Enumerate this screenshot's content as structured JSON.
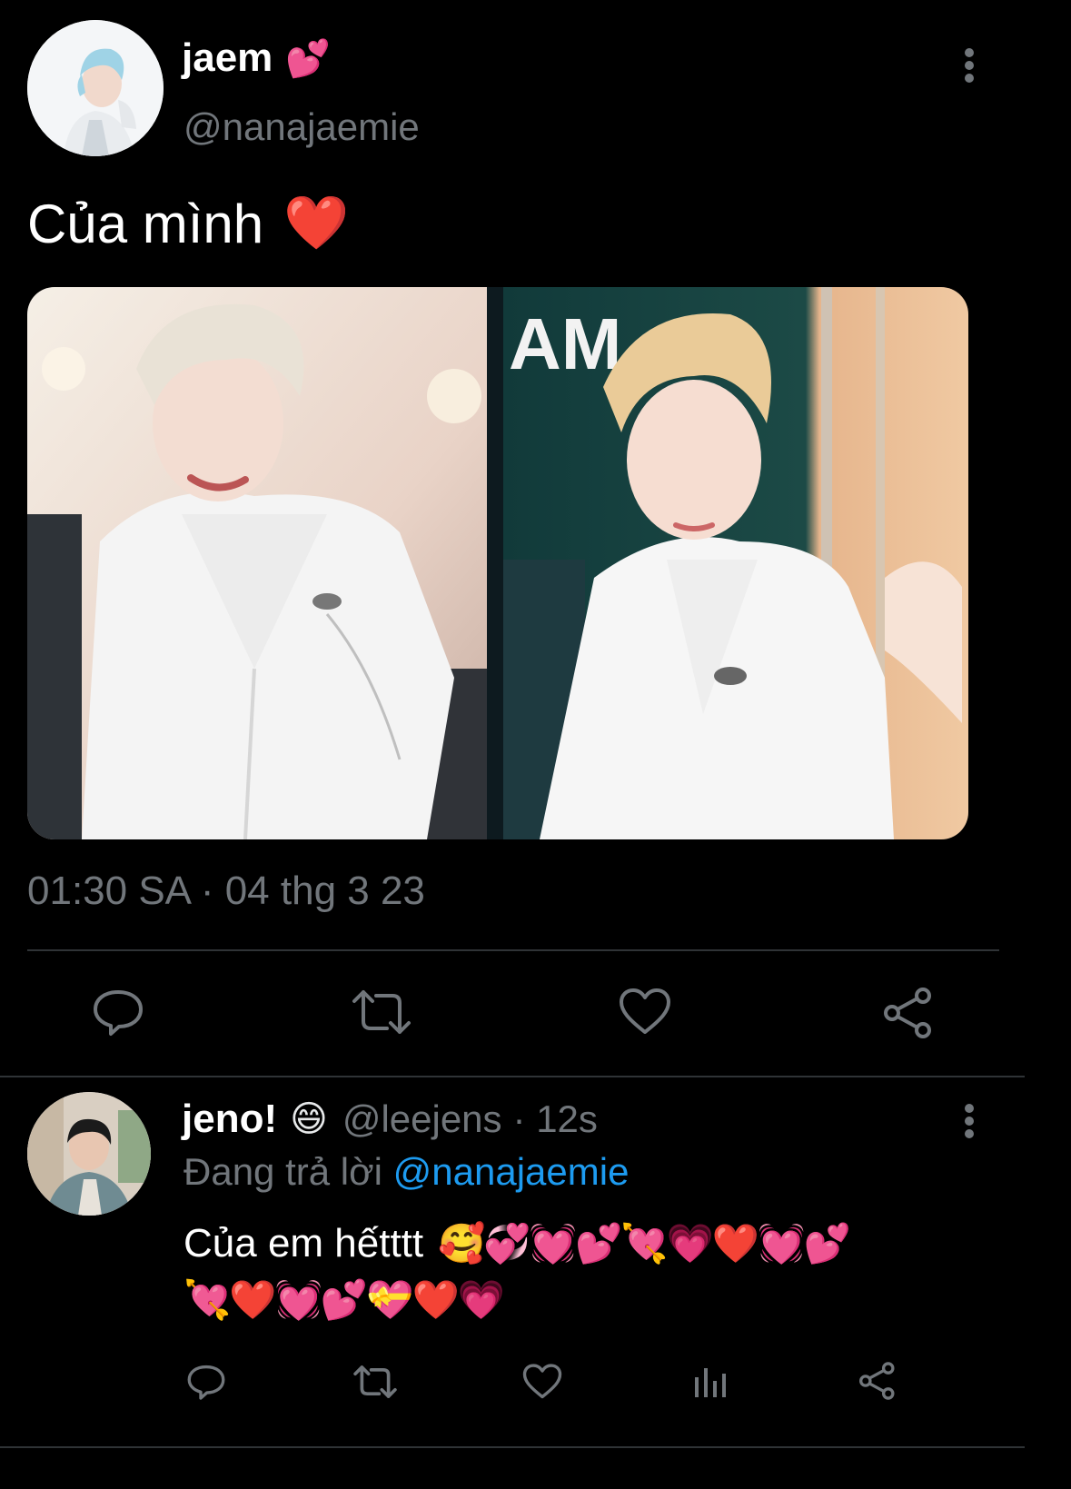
{
  "main_tweet": {
    "author_name": "jaem",
    "author_emoji": "💕",
    "handle": "@nanajaemie",
    "text": "Của mình",
    "text_emoji": "❤️",
    "timestamp": "01:30 SA · 04 thg 3 23",
    "actions": [
      "reply-icon",
      "retweet-icon",
      "like-icon",
      "share-icon"
    ]
  },
  "reply_tweet": {
    "author_name": "jeno!",
    "author_emoji": "😄",
    "handle": "@leejens",
    "time": "· 12s",
    "replying_label": "Đang trả lời",
    "replying_to": "@nanajaemie",
    "text": "Của em hếtttt",
    "emojis_line1": "🥰💞💓💕💘💗❤️💓💕",
    "emojis_line2": "💘❤️💓💕💝❤️💗",
    "actions": [
      "reply-icon",
      "retweet-icon",
      "like-icon",
      "analytics-icon",
      "share-icon"
    ]
  },
  "colors": {
    "background": "#000000",
    "text": "#e7e9ea",
    "muted": "#71767b",
    "link": "#1d9bf0",
    "divider": "#2f3336"
  }
}
